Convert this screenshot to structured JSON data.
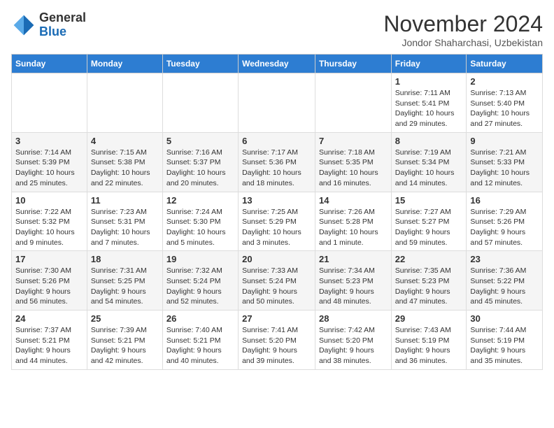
{
  "logo": {
    "general": "General",
    "blue": "Blue"
  },
  "title": "November 2024",
  "location": "Jondor Shaharchasi, Uzbekistan",
  "headers": [
    "Sunday",
    "Monday",
    "Tuesday",
    "Wednesday",
    "Thursday",
    "Friday",
    "Saturday"
  ],
  "weeks": [
    [
      {
        "day": "",
        "info": ""
      },
      {
        "day": "",
        "info": ""
      },
      {
        "day": "",
        "info": ""
      },
      {
        "day": "",
        "info": ""
      },
      {
        "day": "",
        "info": ""
      },
      {
        "day": "1",
        "info": "Sunrise: 7:11 AM\nSunset: 5:41 PM\nDaylight: 10 hours and 29 minutes."
      },
      {
        "day": "2",
        "info": "Sunrise: 7:13 AM\nSunset: 5:40 PM\nDaylight: 10 hours and 27 minutes."
      }
    ],
    [
      {
        "day": "3",
        "info": "Sunrise: 7:14 AM\nSunset: 5:39 PM\nDaylight: 10 hours and 25 minutes."
      },
      {
        "day": "4",
        "info": "Sunrise: 7:15 AM\nSunset: 5:38 PM\nDaylight: 10 hours and 22 minutes."
      },
      {
        "day": "5",
        "info": "Sunrise: 7:16 AM\nSunset: 5:37 PM\nDaylight: 10 hours and 20 minutes."
      },
      {
        "day": "6",
        "info": "Sunrise: 7:17 AM\nSunset: 5:36 PM\nDaylight: 10 hours and 18 minutes."
      },
      {
        "day": "7",
        "info": "Sunrise: 7:18 AM\nSunset: 5:35 PM\nDaylight: 10 hours and 16 minutes."
      },
      {
        "day": "8",
        "info": "Sunrise: 7:19 AM\nSunset: 5:34 PM\nDaylight: 10 hours and 14 minutes."
      },
      {
        "day": "9",
        "info": "Sunrise: 7:21 AM\nSunset: 5:33 PM\nDaylight: 10 hours and 12 minutes."
      }
    ],
    [
      {
        "day": "10",
        "info": "Sunrise: 7:22 AM\nSunset: 5:32 PM\nDaylight: 10 hours and 9 minutes."
      },
      {
        "day": "11",
        "info": "Sunrise: 7:23 AM\nSunset: 5:31 PM\nDaylight: 10 hours and 7 minutes."
      },
      {
        "day": "12",
        "info": "Sunrise: 7:24 AM\nSunset: 5:30 PM\nDaylight: 10 hours and 5 minutes."
      },
      {
        "day": "13",
        "info": "Sunrise: 7:25 AM\nSunset: 5:29 PM\nDaylight: 10 hours and 3 minutes."
      },
      {
        "day": "14",
        "info": "Sunrise: 7:26 AM\nSunset: 5:28 PM\nDaylight: 10 hours and 1 minute."
      },
      {
        "day": "15",
        "info": "Sunrise: 7:27 AM\nSunset: 5:27 PM\nDaylight: 9 hours and 59 minutes."
      },
      {
        "day": "16",
        "info": "Sunrise: 7:29 AM\nSunset: 5:26 PM\nDaylight: 9 hours and 57 minutes."
      }
    ],
    [
      {
        "day": "17",
        "info": "Sunrise: 7:30 AM\nSunset: 5:26 PM\nDaylight: 9 hours and 56 minutes."
      },
      {
        "day": "18",
        "info": "Sunrise: 7:31 AM\nSunset: 5:25 PM\nDaylight: 9 hours and 54 minutes."
      },
      {
        "day": "19",
        "info": "Sunrise: 7:32 AM\nSunset: 5:24 PM\nDaylight: 9 hours and 52 minutes."
      },
      {
        "day": "20",
        "info": "Sunrise: 7:33 AM\nSunset: 5:24 PM\nDaylight: 9 hours and 50 minutes."
      },
      {
        "day": "21",
        "info": "Sunrise: 7:34 AM\nSunset: 5:23 PM\nDaylight: 9 hours and 48 minutes."
      },
      {
        "day": "22",
        "info": "Sunrise: 7:35 AM\nSunset: 5:23 PM\nDaylight: 9 hours and 47 minutes."
      },
      {
        "day": "23",
        "info": "Sunrise: 7:36 AM\nSunset: 5:22 PM\nDaylight: 9 hours and 45 minutes."
      }
    ],
    [
      {
        "day": "24",
        "info": "Sunrise: 7:37 AM\nSunset: 5:21 PM\nDaylight: 9 hours and 44 minutes."
      },
      {
        "day": "25",
        "info": "Sunrise: 7:39 AM\nSunset: 5:21 PM\nDaylight: 9 hours and 42 minutes."
      },
      {
        "day": "26",
        "info": "Sunrise: 7:40 AM\nSunset: 5:21 PM\nDaylight: 9 hours and 40 minutes."
      },
      {
        "day": "27",
        "info": "Sunrise: 7:41 AM\nSunset: 5:20 PM\nDaylight: 9 hours and 39 minutes."
      },
      {
        "day": "28",
        "info": "Sunrise: 7:42 AM\nSunset: 5:20 PM\nDaylight: 9 hours and 38 minutes."
      },
      {
        "day": "29",
        "info": "Sunrise: 7:43 AM\nSunset: 5:19 PM\nDaylight: 9 hours and 36 minutes."
      },
      {
        "day": "30",
        "info": "Sunrise: 7:44 AM\nSunset: 5:19 PM\nDaylight: 9 hours and 35 minutes."
      }
    ]
  ]
}
